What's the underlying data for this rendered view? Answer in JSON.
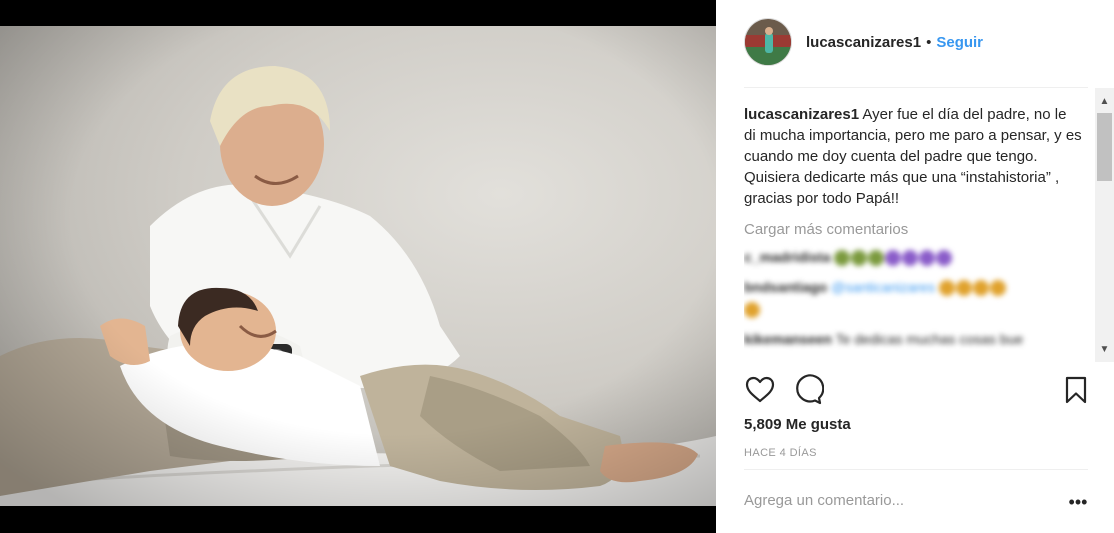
{
  "post": {
    "username": "lucascanizares1",
    "separator": "•",
    "follow_label": "Seguir",
    "caption_user": "lucascanizares1",
    "caption_text": "Ayer fue el día del padre, no le di mucha importancia, pero me paro a pensar, y es cuando me doy cuenta del padre que tengo. Quisiera dedicarte más que una “instahistoria” , gracias por todo Papá!!",
    "load_more_label": "Cargar más comentarios",
    "likes": "5,809 Me gusta",
    "time": "HACE 4 DÍAS",
    "add_comment_placeholder": "Agrega un comentario...",
    "more_label": "•••"
  },
  "blurred_comments": [
    {
      "user": "c_madridista",
      "text": ""
    },
    {
      "user": "bndsantiago",
      "text": "@santicanizares"
    },
    {
      "user": "kikemanseen",
      "text": "Te dedicas muchas cosas bue"
    }
  ],
  "colors": {
    "accent": "#3897f0",
    "muted": "#999999",
    "text": "#262626"
  },
  "icons": {
    "like": "heart-icon",
    "comment": "comment-bubble-icon",
    "save": "bookmark-icon",
    "more": "ellipsis-icon"
  }
}
